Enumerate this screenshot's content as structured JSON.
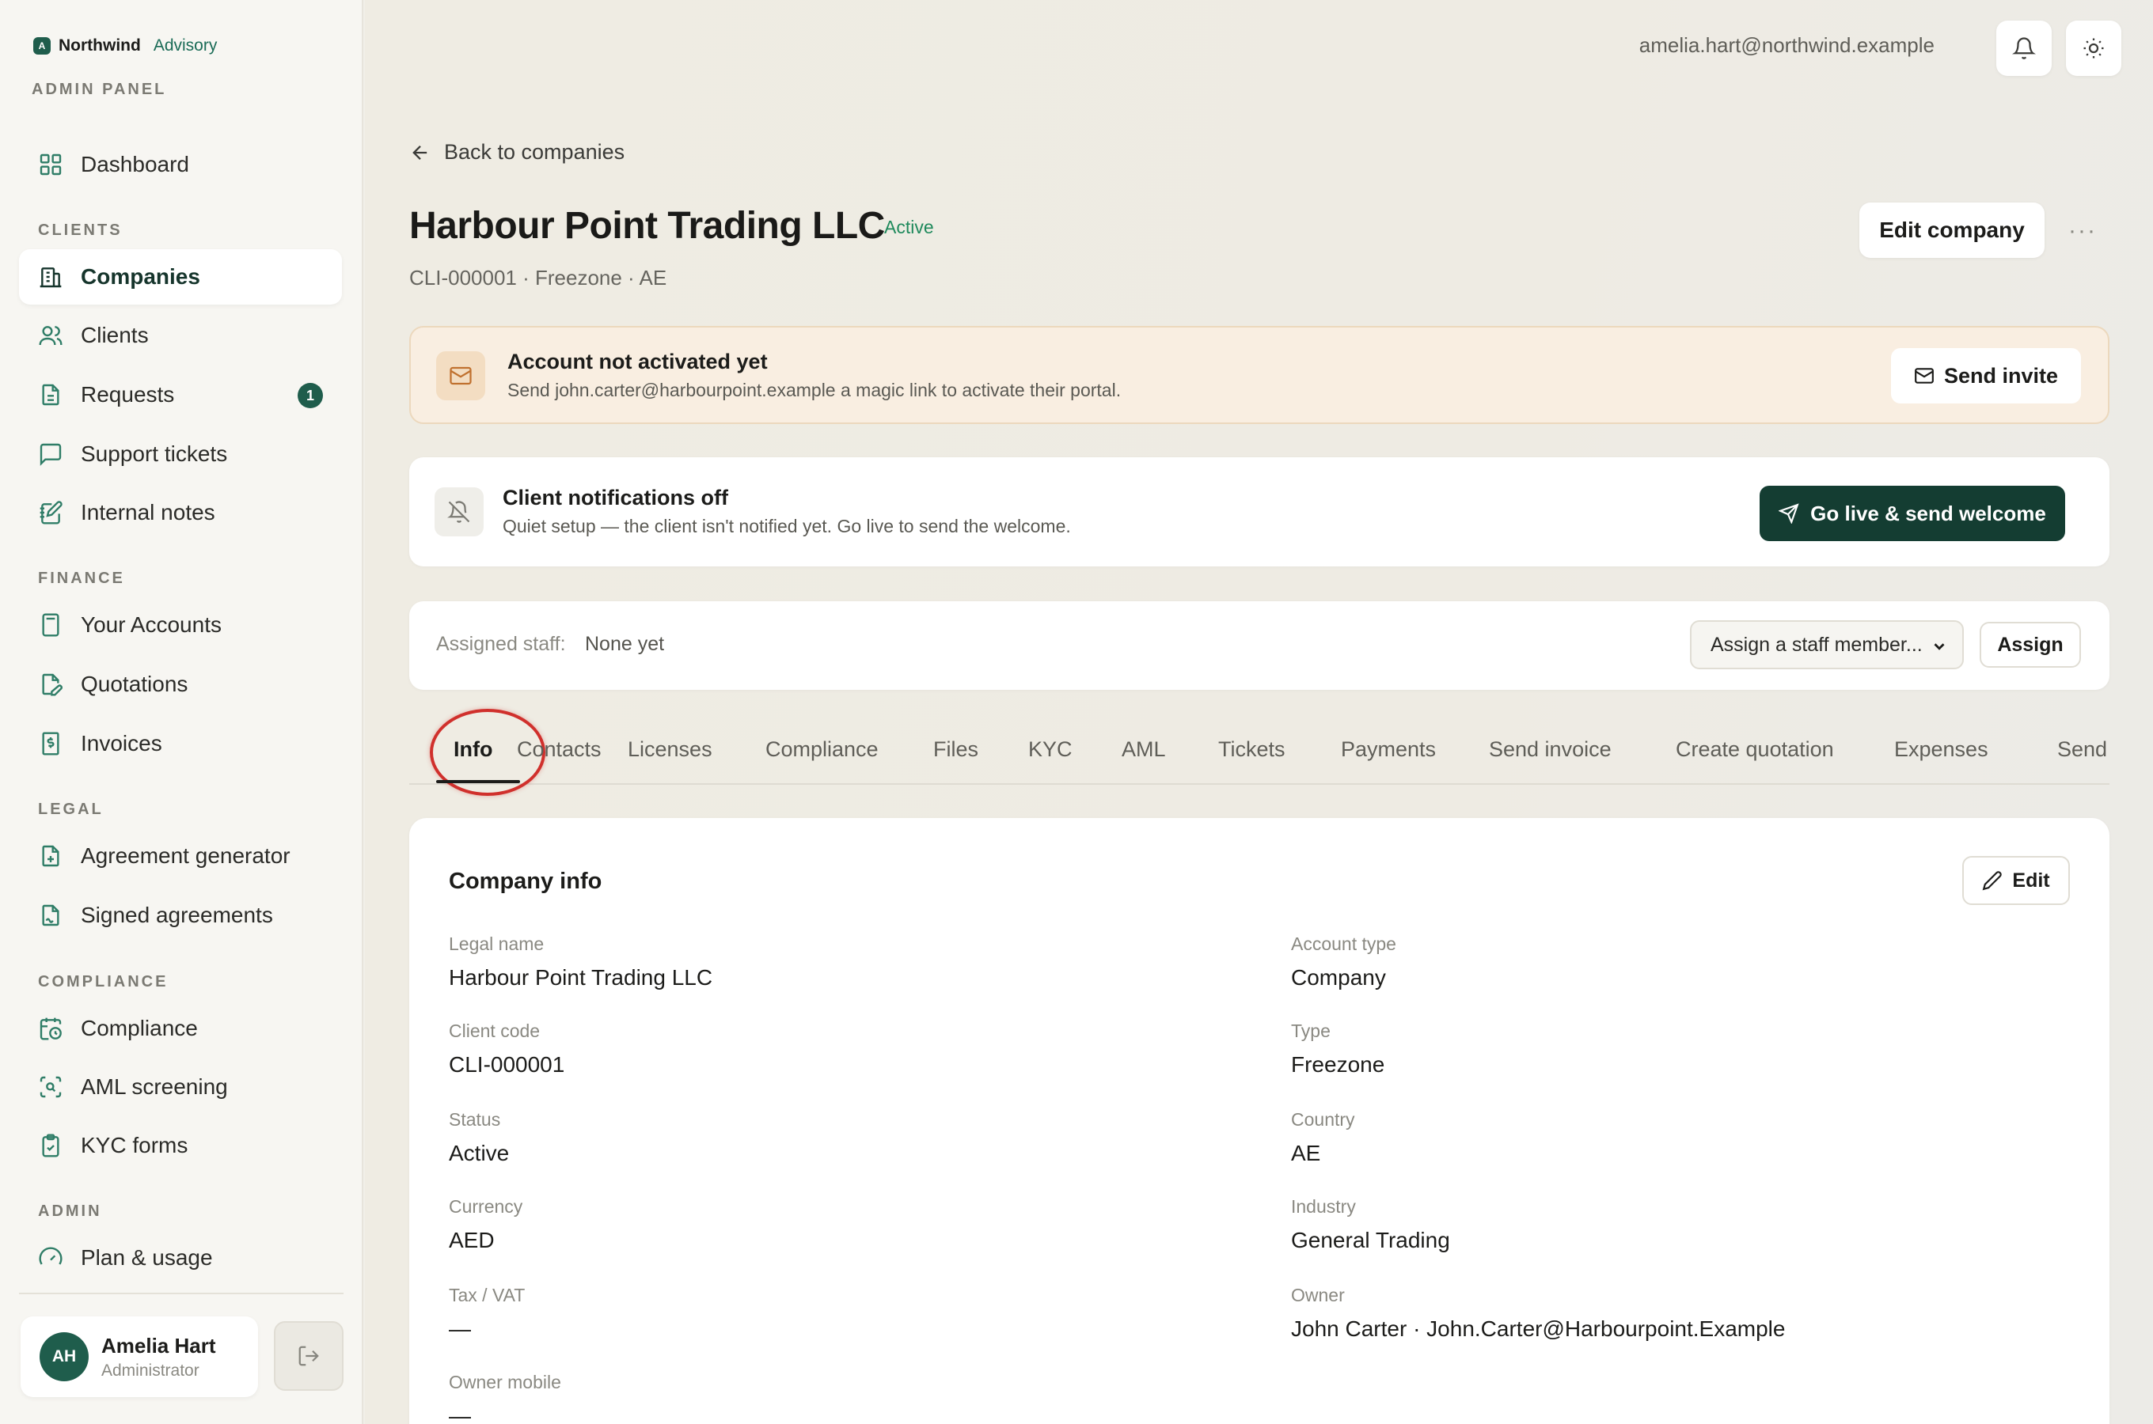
{
  "brand": {
    "name": "Northwind",
    "sub": "Advisory",
    "mark": "A",
    "panel": "ADMIN PANEL"
  },
  "sidebar": {
    "dashboard": "Dashboard",
    "sections": {
      "clients": "CLIENTS",
      "finance": "FINANCE",
      "legal": "LEGAL",
      "compliance": "COMPLIANCE",
      "admin": "ADMIN"
    },
    "items": {
      "companies": "Companies",
      "clients": "Clients",
      "requests": "Requests",
      "requests_badge": "1",
      "support": "Support tickets",
      "notes": "Internal notes",
      "accounts": "Your Accounts",
      "quotations": "Quotations",
      "invoices": "Invoices",
      "agreement": "Agreement generator",
      "signed": "Signed agreements",
      "compliance": "Compliance",
      "aml": "AML screening",
      "kyc": "KYC forms",
      "plan": "Plan & usage"
    },
    "user": {
      "initials": "AH",
      "name": "Amelia Hart",
      "role": "Administrator"
    }
  },
  "topbar": {
    "email": "amelia.hart@northwind.example"
  },
  "page": {
    "back": "Back to companies",
    "title": "Harbour Point Trading LLC",
    "status": "Active",
    "subline": "CLI-000001 · Freezone · AE",
    "edit_company": "Edit company",
    "more": "···"
  },
  "banners": {
    "invite": {
      "title": "Account not activated yet",
      "text": "Send john.carter@harbourpoint.example a magic link to activate their portal.",
      "button": "Send invite"
    },
    "notifications": {
      "title": "Client notifications off",
      "text": "Quiet setup — the client isn't notified yet. Go live to send the welcome.",
      "button": "Go live & send welcome"
    }
  },
  "staff": {
    "label": "Assigned staff:",
    "value": "None yet",
    "select": "Assign a staff member...",
    "button": "Assign"
  },
  "tabs": {
    "info": "Info",
    "contacts": "Contacts",
    "licenses": "Licenses",
    "compliance": "Compliance",
    "files": "Files",
    "kyc": "KYC",
    "aml": "AML",
    "tickets": "Tickets",
    "payments": "Payments",
    "send_invoice": "Send invoice",
    "create_quotation": "Create quotation",
    "expenses": "Expenses",
    "send": "Send"
  },
  "info": {
    "title": "Company info",
    "edit": "Edit",
    "legal_name": {
      "label": "Legal name",
      "value": "Harbour Point Trading LLC"
    },
    "account_type": {
      "label": "Account type",
      "value": "Company"
    },
    "client_code": {
      "label": "Client code",
      "value": "CLI-000001"
    },
    "type": {
      "label": "Type",
      "value": "Freezone"
    },
    "status": {
      "label": "Status",
      "value": "Active"
    },
    "country": {
      "label": "Country",
      "value": "AE"
    },
    "currency": {
      "label": "Currency",
      "value": "AED"
    },
    "industry": {
      "label": "Industry",
      "value": "General Trading"
    },
    "tax": {
      "label": "Tax / VAT",
      "value": "—"
    },
    "owner": {
      "label": "Owner",
      "value": "John Carter · John.Carter@Harbourpoint.Example"
    },
    "owner_mobile": {
      "label": "Owner mobile",
      "value": "—"
    }
  },
  "colors": {
    "accent": "#1f5d4c",
    "dark_button": "#143d32",
    "status_green": "#1f8a5c",
    "warn_bg": "#f9eee1",
    "highlight_ring": "#d0302c"
  }
}
